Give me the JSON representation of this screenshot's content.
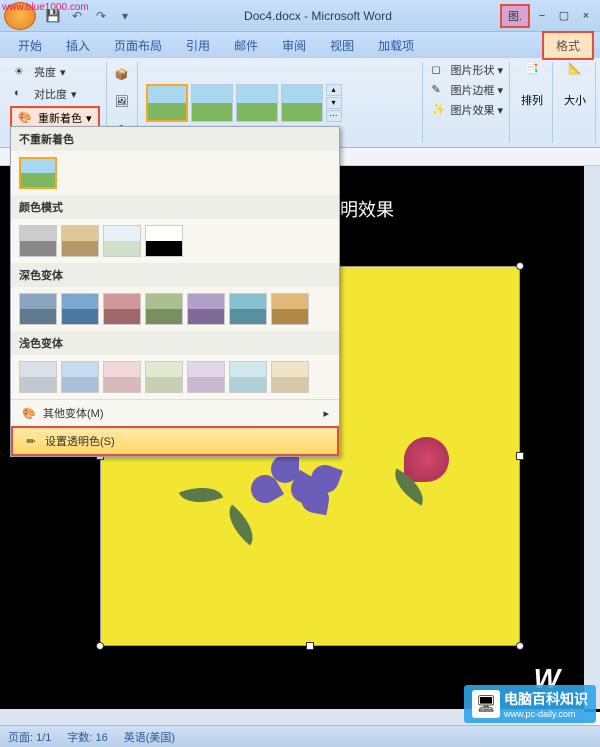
{
  "watermarks": {
    "top_left": "www.blue1000.com",
    "bottom_right_text": "电脑百科知识",
    "bottom_right_url": "www.pc-daily.com",
    "logo_partial": "W"
  },
  "title_bar": {
    "document": "Doc4.docx - Microsoft Word",
    "context_label": "图.",
    "minimize": "−",
    "restore": "▢",
    "close": "×"
  },
  "ribbon_tabs": {
    "items": [
      "开始",
      "插入",
      "页面布局",
      "引用",
      "邮件",
      "审阅",
      "视图",
      "加载项"
    ],
    "format_tab": "格式"
  },
  "ribbon": {
    "brightness": "亮度",
    "contrast": "对比度",
    "recolor": "重新着色",
    "picture_shape": "图片形状",
    "picture_border": "图片边框",
    "picture_effects": "图片效果",
    "arrange": "排列",
    "size": "大小"
  },
  "dropdown": {
    "no_recolor": "不重新着色",
    "color_modes": "颜色模式",
    "dark_variations": "深色变体",
    "light_variations": "浅色变体",
    "more_variations": "其他变体(M)",
    "set_transparent": "设置透明色(S)"
  },
  "document": {
    "visible_text": "明效果"
  },
  "status_bar": {
    "page": "页面: 1/1",
    "words": "字数: 16",
    "language": "英语(美国)"
  }
}
